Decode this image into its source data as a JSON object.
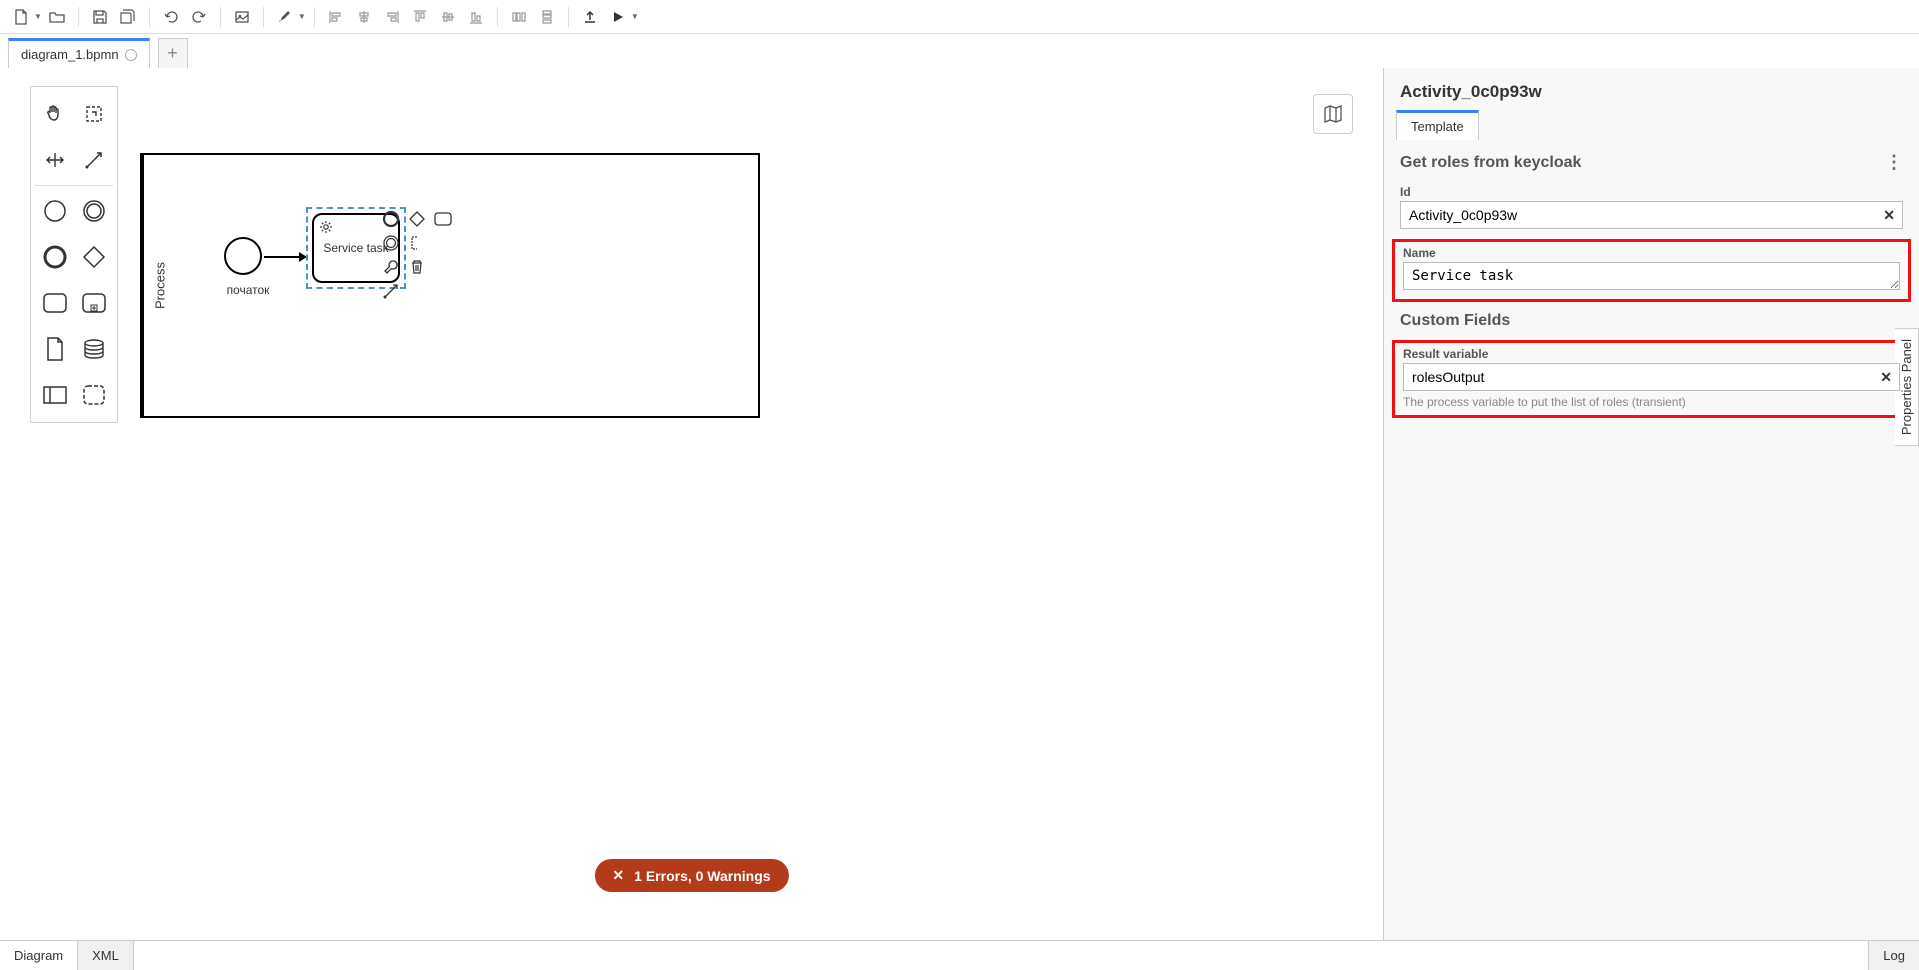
{
  "tabs": {
    "file": "diagram_1.bpmn"
  },
  "palette": {
    "tools": [
      "hand",
      "lasso",
      "space",
      "connect",
      "start-event",
      "end-event",
      "intermediate-event-bold",
      "gateway",
      "task",
      "subprocess",
      "data-object",
      "data-store",
      "participant",
      "group"
    ]
  },
  "canvas": {
    "pool_label": "Process",
    "start_event_label": "початок",
    "task_label": "Service task"
  },
  "properties": {
    "title": "Activity_0c0p93w",
    "tab_template": "Template",
    "section1_title": "Get roles from keycloak",
    "id_label": "Id",
    "id_value": "Activity_0c0p93w",
    "name_label": "Name",
    "name_value": "Service task",
    "section2_title": "Custom Fields",
    "result_var_label": "Result variable",
    "result_var_value": "rolesOutput",
    "result_var_desc": "The process variable to put the list of roles (transient)",
    "panel_tab_label": "Properties Panel"
  },
  "errors": {
    "pill": "1 Errors, 0 Warnings"
  },
  "bottom": {
    "diagram": "Diagram",
    "xml": "XML",
    "log": "Log"
  }
}
